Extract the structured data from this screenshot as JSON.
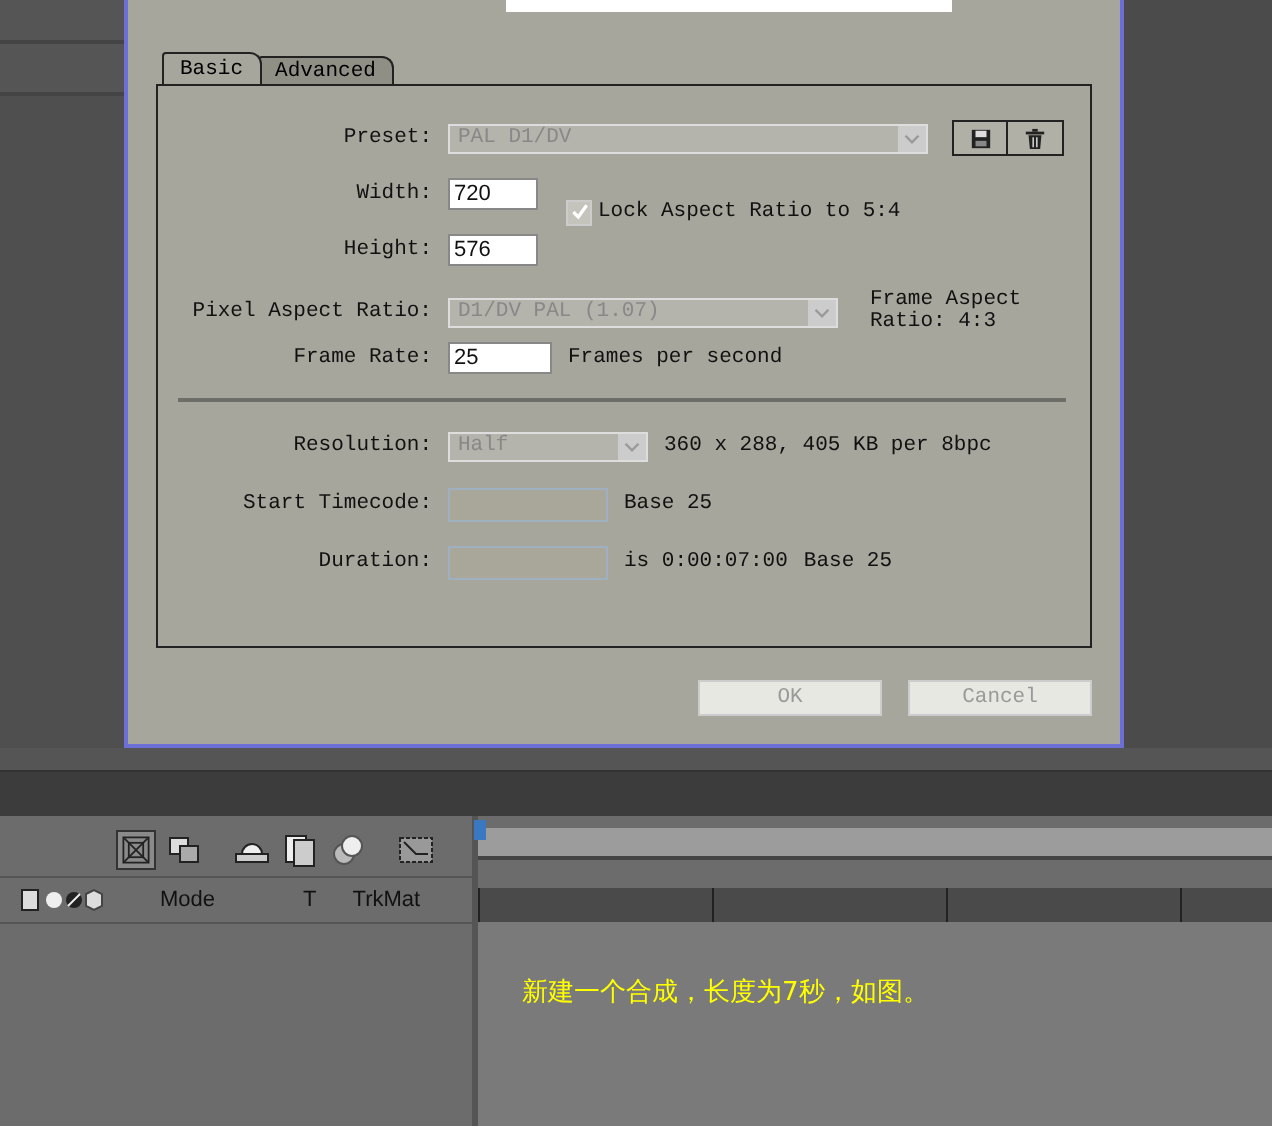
{
  "dialog": {
    "tabs": [
      {
        "label": "Basic",
        "selected": true
      },
      {
        "label": "Advanced",
        "selected": false
      }
    ],
    "preset": {
      "label": "Preset:",
      "value": "PAL D1/DV",
      "disabled": true
    },
    "width": {
      "label": "Width:",
      "value": "720"
    },
    "height": {
      "label": "Height:",
      "value": "576"
    },
    "lock_aspect": {
      "label": "Lock Aspect Ratio to 5:4",
      "checked": true
    },
    "pixel_aspect": {
      "label": "Pixel Aspect Ratio:",
      "value": "D1/DV PAL (1.07)",
      "disabled": true
    },
    "frame_aspect": "Frame Aspect Ratio: 4:3",
    "frame_rate": {
      "label": "Frame Rate:",
      "value": "25",
      "unit": "Frames per second"
    },
    "resolution": {
      "label": "Resolution:",
      "value": "Half",
      "info": "360 x 288, 405 KB per 8bpc",
      "disabled": true
    },
    "start_timecode": {
      "label": "Start Timecode:",
      "base": "Base 25",
      "disabled": true
    },
    "duration": {
      "label": "Duration:",
      "info": "is 0:00:07:00",
      "base": "Base 25",
      "disabled": true
    },
    "buttons": [
      {
        "label": "OK",
        "disabled": true
      },
      {
        "label": "Cancel",
        "disabled": true
      }
    ]
  },
  "timeline": {
    "columns": [
      "Mode",
      "T",
      "TrkMat"
    ]
  },
  "caption": "新建一个合成，长度为7秒，如图。"
}
